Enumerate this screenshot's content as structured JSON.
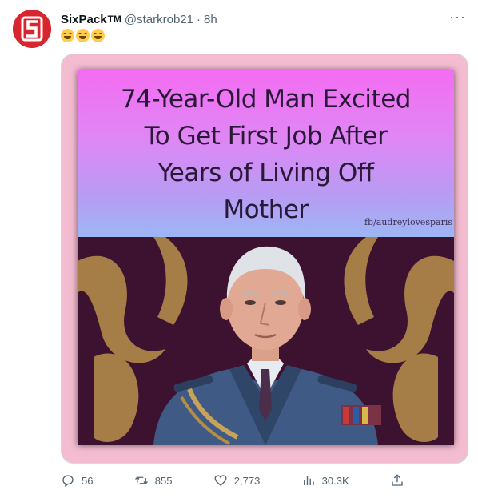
{
  "tweet": {
    "display_name": "SixPack",
    "trademark": "TM",
    "handle": "@starkrob21",
    "separator": "·",
    "time": "8h",
    "emoji": [
      "grinning-squinting-face",
      "grinning-squinting-face",
      "grinning-squinting-face"
    ]
  },
  "media": {
    "headline_lines": [
      "74-Year-Old Man Excited",
      "To Get First Job After",
      "Years of Living Off",
      "Mother"
    ],
    "credit": "fb/audreylovesparis"
  },
  "actions": {
    "replies": "56",
    "retweets": "855",
    "likes": "2,773",
    "views": "30.3K"
  },
  "colors": {
    "avatar": "#d9262e",
    "muted": "#536471",
    "headline_top": "#f36cf2",
    "headline_bottom": "#9db6f4",
    "frame": "#f4bcd0"
  }
}
